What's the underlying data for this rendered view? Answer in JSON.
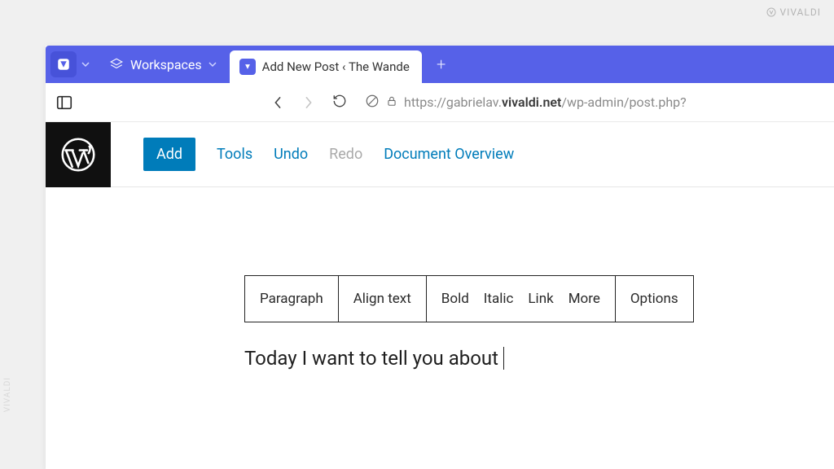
{
  "watermark": "VIVALDI",
  "tabstrip": {
    "workspaces_label": "Workspaces",
    "tab_title": "Add New Post ‹ The Wande",
    "newtab_glyph": "+"
  },
  "urlbar": {
    "back_glyph": "‹",
    "forward_glyph": "›",
    "reload_glyph": "⟳",
    "url_prefix": "https://gabrielav.",
    "url_host": "vivaldi.net",
    "url_path": "/wp-admin/post.php?"
  },
  "wp_toolbar": {
    "add": "Add",
    "tools": "Tools",
    "undo": "Undo",
    "redo": "Redo",
    "overview": "Document Overview"
  },
  "block_toolbar": {
    "paragraph": "Paragraph",
    "align": "Align text",
    "bold": "Bold",
    "italic": "Italic",
    "link": "Link",
    "more": "More",
    "options": "Options"
  },
  "editor": {
    "text": "Today I want to tell you about"
  }
}
